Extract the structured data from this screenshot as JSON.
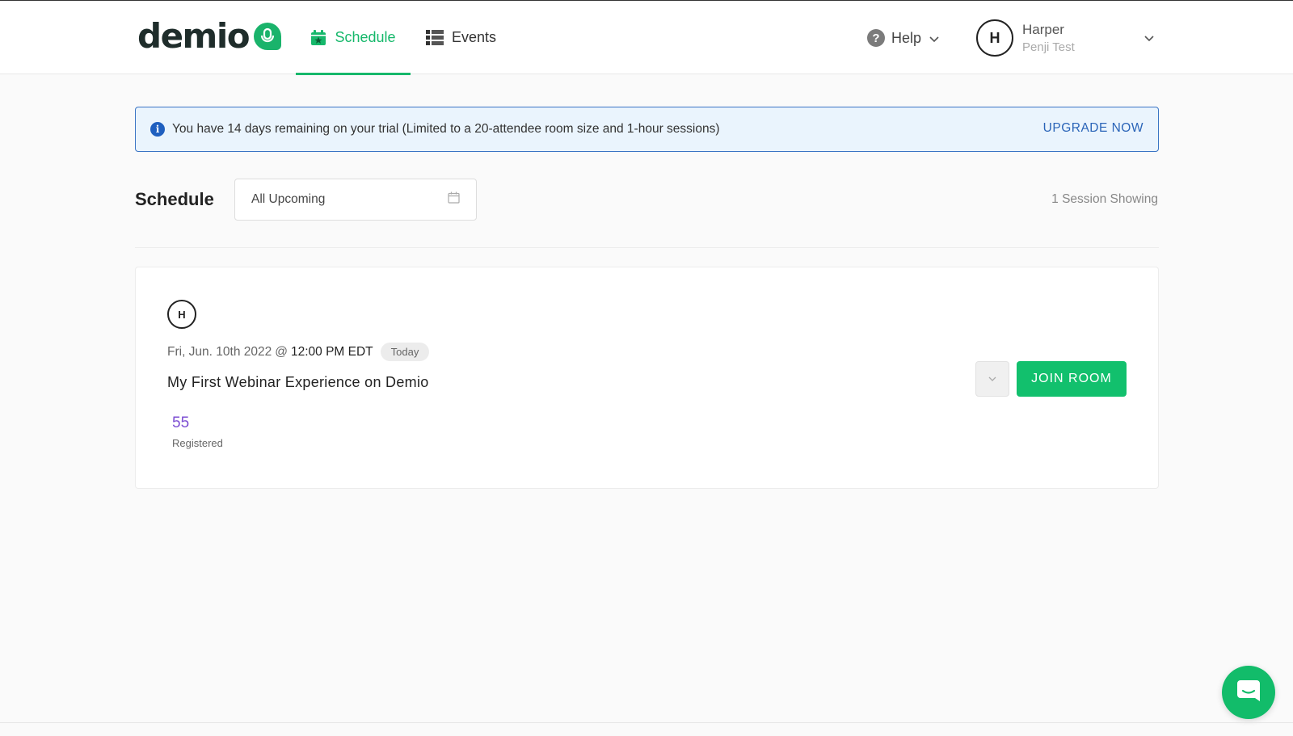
{
  "brand": {
    "name": "demio",
    "accent": "#16b86b"
  },
  "nav": {
    "tabs": [
      {
        "label": "Schedule",
        "icon": "calendar-star-icon",
        "active": true
      },
      {
        "label": "Events",
        "icon": "list-icon",
        "active": false
      }
    ],
    "help_label": "Help",
    "user": {
      "initial": "H",
      "name": "Harper",
      "org": "Penji Test"
    }
  },
  "banner": {
    "message": "You have 14 days remaining on your trial (Limited to a 20-attendee room size and 1-hour sessions)",
    "action": "UPGRADE NOW"
  },
  "schedule": {
    "title": "Schedule",
    "filter_value": "All Upcoming",
    "count_text": "1 Session Showing"
  },
  "session": {
    "host_initial": "H",
    "date": "Fri, Jun. 10th 2022",
    "at": "@",
    "time": "12:00 PM EDT",
    "badge": "Today",
    "title": "My First Webinar Experience on Demio",
    "registered_count": "55",
    "registered_label": "Registered",
    "join_label": "JOIN ROOM"
  }
}
